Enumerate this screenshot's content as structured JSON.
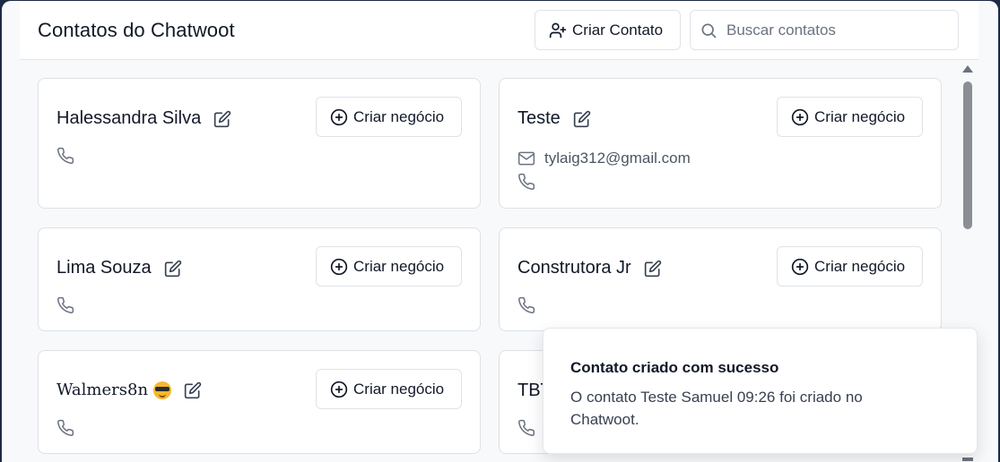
{
  "header": {
    "title": "Contatos do Chatwoot",
    "create_contact_label": "Criar Contato",
    "search_placeholder": "Buscar contatos"
  },
  "deal_button_label": "Criar negócio",
  "contacts": [
    {
      "name": "Halessandra Silva",
      "email": "",
      "emoji": ""
    },
    {
      "name": "Teste",
      "email": "tylaig312@gmail.com",
      "emoji": ""
    },
    {
      "name": "Lima Souza",
      "email": "",
      "emoji": ""
    },
    {
      "name": "Construtora Jr",
      "email": "",
      "emoji": ""
    },
    {
      "name": "Walmers8n",
      "email": "",
      "emoji": "smiling-face-with-sunglasses"
    },
    {
      "name": "TBT",
      "email": "",
      "emoji": ""
    }
  ],
  "toast": {
    "title": "Contato criado com sucesso",
    "message": "O contato Teste Samuel 09:26 foi criado no Chatwoot."
  },
  "icons": {
    "create_contact": "user-plus-icon",
    "search": "search-icon",
    "edit": "edit-icon",
    "add": "plus-circle-icon",
    "email": "mail-icon",
    "phone": "phone-icon"
  }
}
